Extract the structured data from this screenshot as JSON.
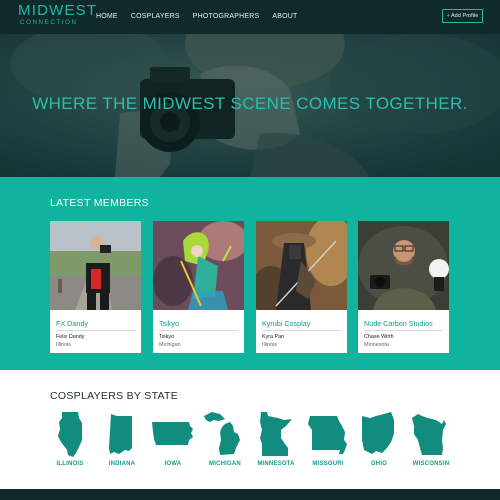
{
  "logo": {
    "top": "MIDWEST",
    "bottom": "CONNECTION"
  },
  "nav": {
    "links": [
      "HOME",
      "COSPLAYERS",
      "PHOTOGRAPHERS",
      "ABOUT"
    ],
    "add_profile": "Add Profile"
  },
  "hero": {
    "tagline": "WHERE THE MIDWEST SCENE COMES TOGETHER."
  },
  "members": {
    "title": "LATEST MEMBERS",
    "cards": [
      {
        "name": "FX Dandy",
        "person": "Felix Dandy",
        "state": "Illinois"
      },
      {
        "name": "Tsikyo",
        "person": "Tsikyo",
        "state": "Michigan"
      },
      {
        "name": "Kyrubi Cosplay",
        "person": "Kyra Pan",
        "state": "Illinois"
      },
      {
        "name": "Nude Carbon Studios",
        "person": "Chase Wirth",
        "state": "Minnesota"
      }
    ]
  },
  "states": {
    "title": "COSPLAYERS BY STATE",
    "items": [
      "ILLINOIS",
      "INDIANA",
      "IOWA",
      "MICHIGAN",
      "MINNESOTA",
      "MISSOURI",
      "OHIO",
      "WISCONSIN"
    ]
  },
  "colors": {
    "accent": "#0fb39e",
    "dark": "#102a2c",
    "state_fill": "#128c7e"
  }
}
